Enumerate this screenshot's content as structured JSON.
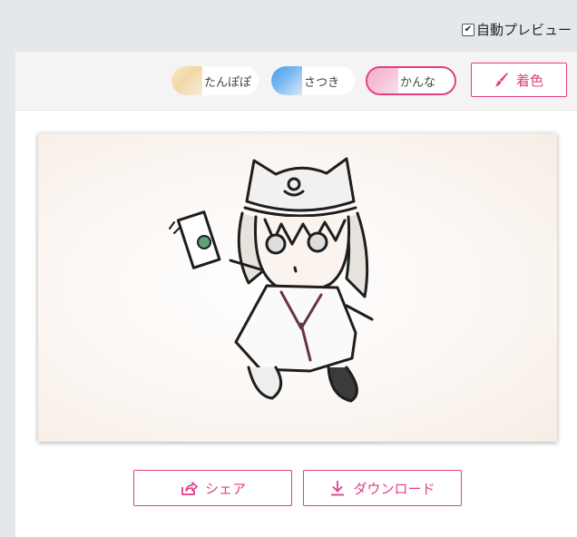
{
  "auto_preview": {
    "label": "自動プレビュー",
    "checked": true
  },
  "styles": [
    {
      "label": "たんぽぽ",
      "selected": false
    },
    {
      "label": "さつき",
      "selected": false
    },
    {
      "label": "かんな",
      "selected": true
    }
  ],
  "color_button": {
    "label": "着色",
    "icon": "brush-icon"
  },
  "actions": {
    "share_label": "シェア",
    "download_label": "ダウンロード"
  },
  "colors": {
    "accent": "#e33d86",
    "background": "#e5e8eb",
    "header": "#f4f4f5"
  }
}
